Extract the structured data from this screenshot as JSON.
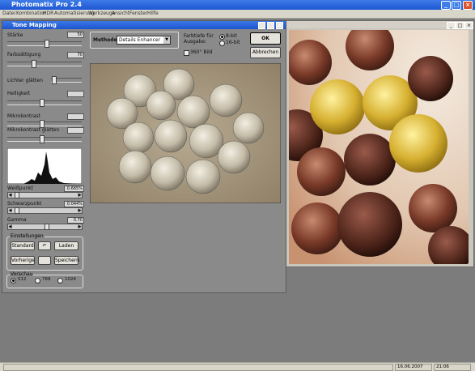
{
  "app": {
    "title": "Photomatix Pro 2.4",
    "window_buttons": [
      "_",
      "□",
      "×"
    ]
  },
  "menu": [
    "Datei",
    "Kombination",
    "HDR",
    "Automatisierung",
    "Werkzeuge",
    "Ansicht",
    "Fenster",
    "Hilfe"
  ],
  "status": {
    "date": "16.06.2007",
    "time": "21:06"
  },
  "dialog": {
    "title": "Tone Mapping",
    "controls": {
      "staerke": {
        "label": "Stärke",
        "value": "50"
      },
      "farbsaettigung": {
        "label": "Farbsättigung",
        "value": "70"
      },
      "lichter_glaetten": {
        "label": "Lichter glätten"
      },
      "helligkeit": {
        "label": "Helligkeit",
        "value": ""
      },
      "mikrokontrast": {
        "label": "Mikrokontrast",
        "value": ""
      },
      "mikrokontrast_glaetten": {
        "label": "Mikrokontrast glätten",
        "value": ""
      },
      "weisspunkt": {
        "label": "Weißpunkt",
        "value": "0.665%"
      },
      "schwarzpunkt": {
        "label": "Schwarzpunkt",
        "value": "0.044%"
      },
      "gamma": {
        "label": "Gamma",
        "value": "0.70"
      }
    },
    "einstellungen": {
      "title": "Einstellungen",
      "standard": "Standard",
      "laden": "Laden",
      "vorherige": "Vorherige",
      "speichern": "Speichern"
    },
    "vorschau": {
      "title": "Vorschau",
      "options": [
        "512",
        "768",
        "1024"
      ]
    },
    "methode": {
      "label": "Methode:",
      "value": "Details Enhancer"
    },
    "farbtiefe": {
      "label": "Farbtiefe für Ausgabe:",
      "options": [
        "8-bit",
        "16-bit"
      ]
    },
    "bild360": "360° Bild",
    "ok": "OK",
    "abbrechen": "Abbrechen"
  },
  "accent": "#1d56d3"
}
